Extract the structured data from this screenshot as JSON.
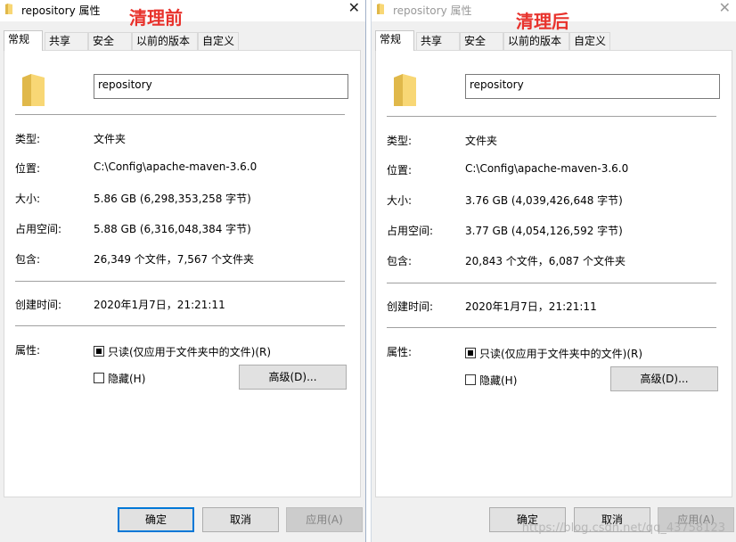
{
  "colors": {
    "folder_yellow": "#f8d775",
    "folder_dark": "#e0b84a",
    "annotation_red": "#e8322c",
    "primary_border": "#0078d7"
  },
  "left": {
    "title": "repository 属性",
    "annotation": "清理前",
    "tabs": [
      "常规",
      "共享",
      "安全",
      "以前的版本",
      "自定义"
    ],
    "folder_name": "repository",
    "rows": {
      "type_label": "类型:",
      "type_value": "文件夹",
      "location_label": "位置:",
      "location_value": "C:\\Config\\apache-maven-3.6.0",
      "size_label": "大小:",
      "size_value": "5.86 GB (6,298,353,258 字节)",
      "disk_label": "占用空间:",
      "disk_value": "5.88 GB (6,316,048,384 字节)",
      "contains_label": "包含:",
      "contains_value": "26,349 个文件，7,567 个文件夹",
      "created_label": "创建时间:",
      "created_value": "2020年1月7日，21:21:11",
      "attr_label": "属性:"
    },
    "readonly_label": "只读(仅应用于文件夹中的文件)(R)",
    "hidden_label": "隐藏(H)",
    "advanced_label": "高级(D)...",
    "ok_label": "确定",
    "cancel_label": "取消",
    "apply_label": "应用(A)"
  },
  "right": {
    "title": "repository 属性",
    "annotation": "清理后",
    "tabs": [
      "常规",
      "共享",
      "安全",
      "以前的版本",
      "自定义"
    ],
    "folder_name": "repository",
    "rows": {
      "type_label": "类型:",
      "type_value": "文件夹",
      "location_label": "位置:",
      "location_value": "C:\\Config\\apache-maven-3.6.0",
      "size_label": "大小:",
      "size_value": "3.76 GB (4,039,426,648 字节)",
      "disk_label": "占用空间:",
      "disk_value": "3.77 GB (4,054,126,592 字节)",
      "contains_label": "包含:",
      "contains_value": "20,843 个文件，6,087 个文件夹",
      "created_label": "创建时间:",
      "created_value": "2020年1月7日，21:21:11",
      "attr_label": "属性:"
    },
    "readonly_label": "只读(仅应用于文件夹中的文件)(R)",
    "hidden_label": "隐藏(H)",
    "advanced_label": "高级(D)...",
    "ok_label": "确定",
    "cancel_label": "取消",
    "apply_label": "应用(A)",
    "watermark": "https://blog.csdn.net/qq_43758123"
  }
}
